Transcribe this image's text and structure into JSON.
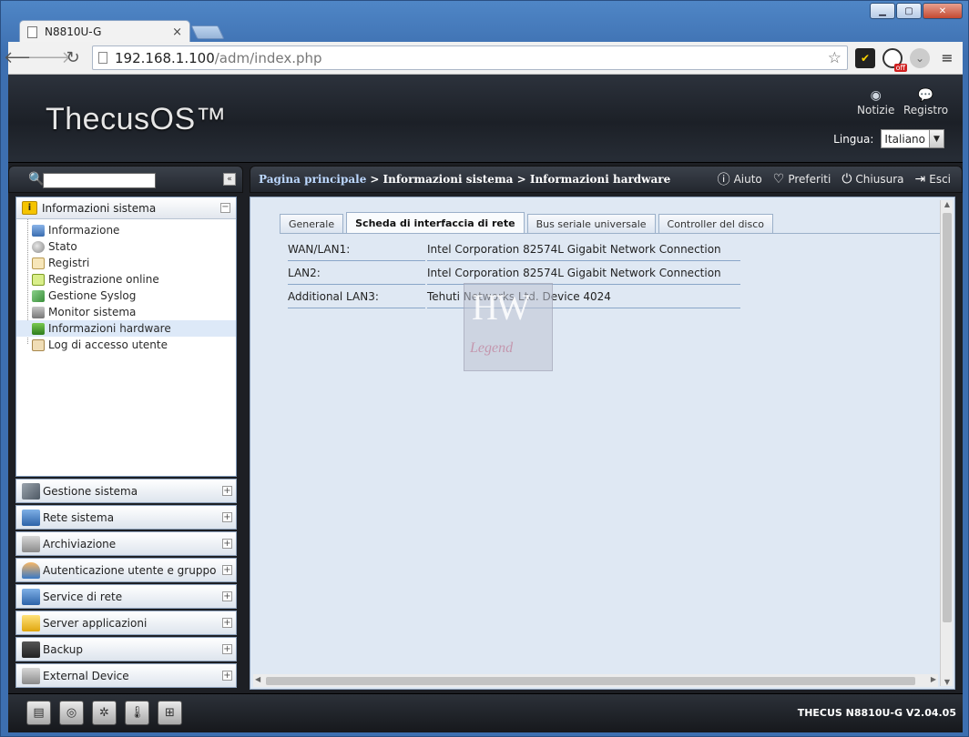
{
  "browser": {
    "tab_title": "N8810U-G",
    "tab_close": "×",
    "url_host": "192.168.1.100",
    "url_path": "/adm/index.php",
    "ext_off_badge": "off"
  },
  "header": {
    "logo": "ThecusOS™",
    "notifications_label": "Notizie",
    "log_label": "Registro",
    "language_label": "Lingua:",
    "language_value": "Italiano"
  },
  "left_panel": {
    "search_placeholder": "",
    "group_title": "Informazioni sistema",
    "tree_items": [
      "Informazione",
      "Stato",
      "Registri",
      "Registrazione online",
      "Gestione Syslog",
      "Monitor sistema",
      "Informazioni hardware",
      "Log di accesso utente"
    ],
    "selected_item": "Informazioni hardware",
    "accordion": [
      "Gestione sistema",
      "Rete sistema",
      "Archiviazione",
      "Autenticazione utente e gruppo",
      "Service di rete",
      "Server applicazioni",
      "Backup",
      "External Device"
    ]
  },
  "breadcrumb": {
    "home": "Pagina principale",
    "rest": "> Informazioni sistema > Informazioni hardware",
    "help": "Aiuto",
    "favorites": "Preferiti",
    "shutdown": "Chiusura",
    "logout": "Esci"
  },
  "tabs": [
    "Generale",
    "Scheda di interfaccia di rete",
    "Bus seriale universale",
    "Controller del disco"
  ],
  "active_tab": "Scheda di interfaccia di rete",
  "nic_rows": [
    {
      "key": "WAN/LAN1:",
      "value": "Intel Corporation 82574L Gigabit Network Connection"
    },
    {
      "key": "LAN2:",
      "value": "Intel Corporation 82574L Gigabit Network Connection"
    },
    {
      "key": "Additional LAN3:",
      "value": "Tehuti Networks Ltd. Device 4024"
    }
  ],
  "watermark": {
    "line1": "HW",
    "line2": "Legend"
  },
  "footer": {
    "version": "THECUS N8810U-G V2.04.05"
  }
}
